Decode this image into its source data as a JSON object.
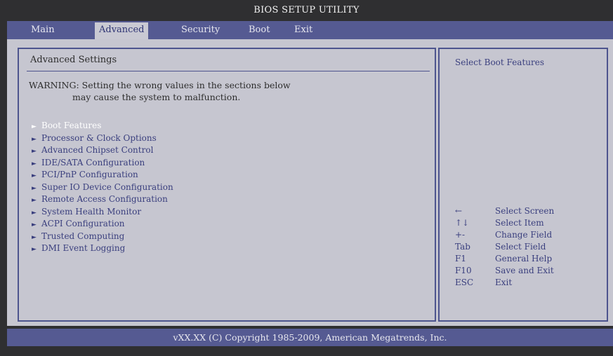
{
  "title": "BIOS SETUP UTILITY",
  "tabs": [
    {
      "label": "Main"
    },
    {
      "label": "Advanced"
    },
    {
      "label": "Security"
    },
    {
      "label": "Boot"
    },
    {
      "label": "Exit"
    }
  ],
  "active_tab": "Advanced",
  "left": {
    "heading": "Advanced Settings",
    "warning_line1": "WARNING: Setting the wrong values in the sections below",
    "warning_line2": "may cause the system to malfunction.",
    "items": [
      {
        "label": "Boot Features",
        "selected": true
      },
      {
        "label": "Processor & Clock Options"
      },
      {
        "label": "Advanced Chipset Control"
      },
      {
        "label": "IDE/SATA Configuration"
      },
      {
        "label": "PCI/PnP Configuration"
      },
      {
        "label": "Super IO Device Configuration"
      },
      {
        "label": "Remote Access Configuration"
      },
      {
        "label": "System Health Monitor"
      },
      {
        "label": "ACPI Configuration"
      },
      {
        "label": "Trusted Computing"
      },
      {
        "label": "DMI Event Logging"
      }
    ],
    "item_arrow": "►"
  },
  "right": {
    "help_text": "Select Boot Features",
    "keys": [
      {
        "key": "←",
        "action": "Select Screen"
      },
      {
        "key": "↑↓",
        "action": "Select Item"
      },
      {
        "key": "+-",
        "action": "Change Field"
      },
      {
        "key": "Tab",
        "action": "Select Field"
      },
      {
        "key": "F1",
        "action": "General Help"
      },
      {
        "key": "F10",
        "action": "Save and Exit"
      },
      {
        "key": "ESC",
        "action": "Exit"
      }
    ]
  },
  "footer": "vXX.XX (C) Copyright 1985-2009, American Megatrends, Inc.",
  "colors": {
    "menubar": "#555a92",
    "panel_bg": "#c6c6d0",
    "item_text": "#3a3f7e",
    "selected_text": "#ffffff"
  }
}
